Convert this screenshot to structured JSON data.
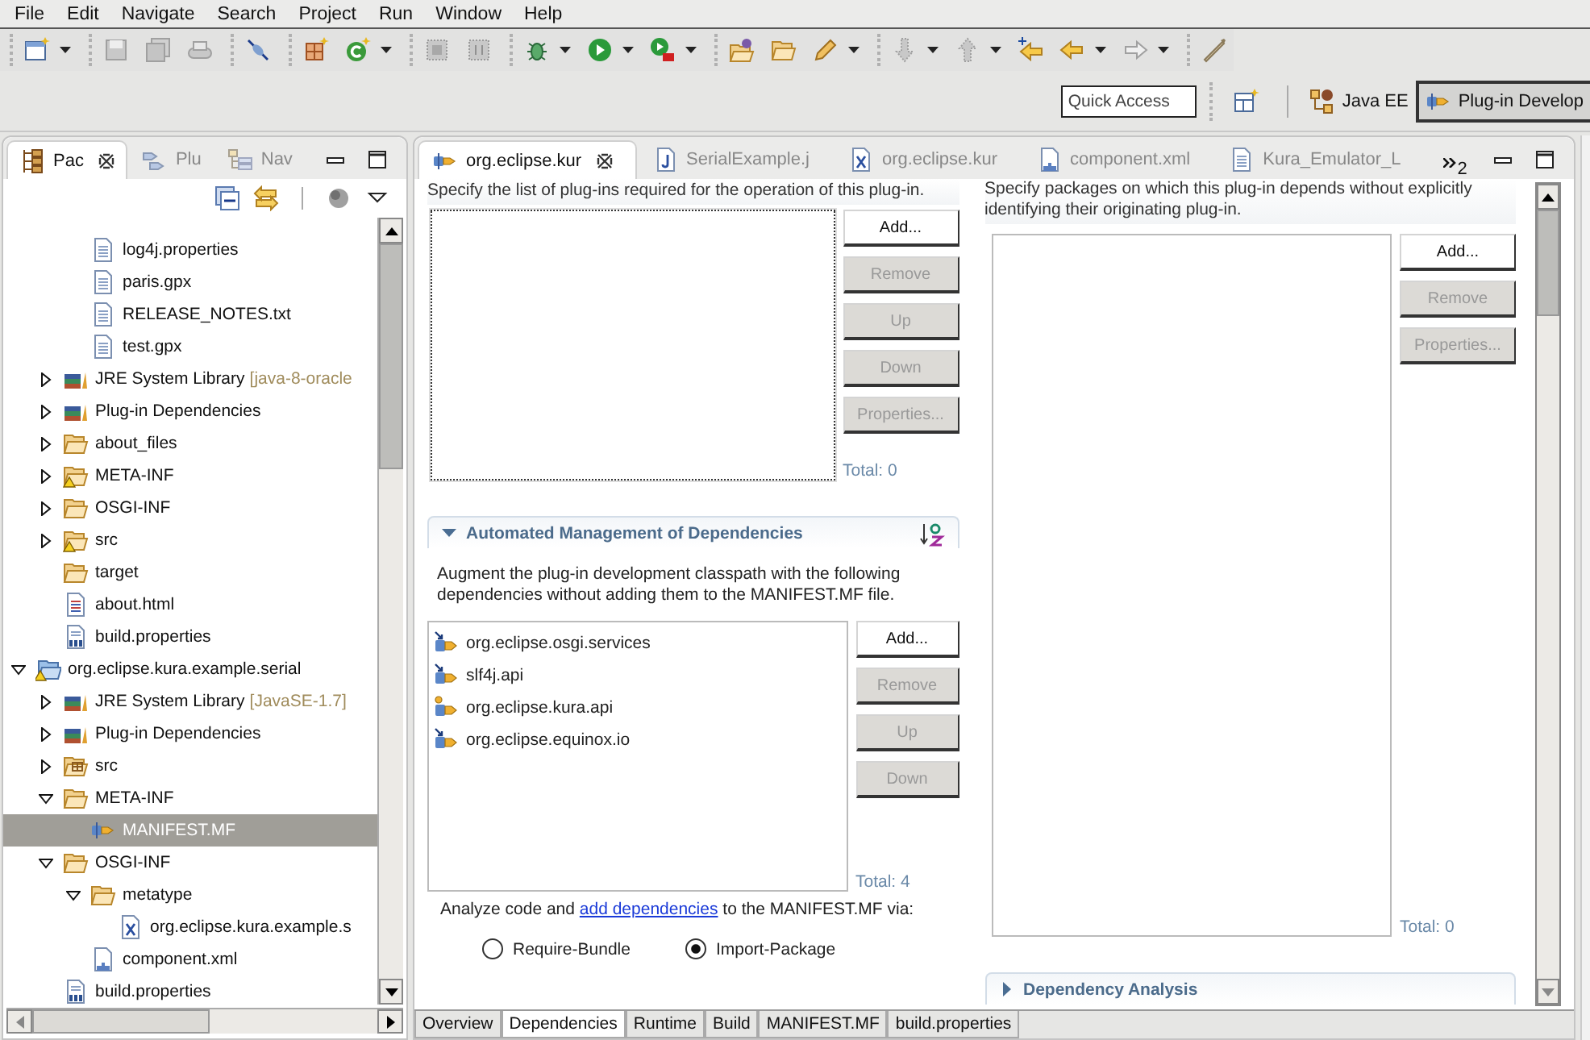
{
  "menu": [
    {
      "label": "File"
    },
    {
      "label": "Edit"
    },
    {
      "label": "Navigate"
    },
    {
      "label": "Search"
    },
    {
      "label": "Project"
    },
    {
      "label": "Run"
    },
    {
      "label": "Window"
    },
    {
      "label": "Help"
    }
  ],
  "quick_access": {
    "placeholder": "Quick Access"
  },
  "perspectives": [
    {
      "label": "Java EE",
      "kind": "java-ee",
      "selected": false
    },
    {
      "label": "Plug-in Develop",
      "kind": "plugin",
      "selected": true
    }
  ],
  "side_panel": {
    "tabs": [
      {
        "label": "Pac",
        "kind": "package",
        "selected": true
      },
      {
        "label": "Plu",
        "kind": "plugins",
        "selected": false
      },
      {
        "label": "Nav",
        "kind": "navigator",
        "selected": false
      }
    ],
    "tree": [
      {
        "children": [
          {
            "children": [
              {
                "label": "log4j.properties",
                "kind": "file",
                "selected": false
              },
              {
                "label": "paris.gpx",
                "kind": "file",
                "selected": false
              },
              {
                "label": "RELEASE_NOTES.txt",
                "kind": "file",
                "selected": false
              },
              {
                "label": "test.gpx",
                "kind": "file",
                "selected": false
              }
            ]
          },
          {
            "label": "JRE System Library",
            "decoration": "[java-8-oracle",
            "kind": "library",
            "expanded": false,
            "selected": false
          },
          {
            "label": "Plug-in Dependencies",
            "kind": "library",
            "expanded": false,
            "selected": false
          },
          {
            "label": "about_files",
            "kind": "folder",
            "expanded": false,
            "selected": false
          },
          {
            "label": "META-INF",
            "kind": "folder-warning",
            "expanded": false,
            "selected": false
          },
          {
            "label": "OSGI-INF",
            "kind": "folder",
            "expanded": false,
            "selected": false
          },
          {
            "label": "src",
            "kind": "folder-warning",
            "expanded": false,
            "selected": false
          },
          {
            "label": "target",
            "kind": "folder",
            "selected": false
          },
          {
            "label": "about.html",
            "kind": "html",
            "selected": false
          },
          {
            "label": "build.properties",
            "kind": "properties",
            "selected": false
          }
        ]
      },
      {
        "label": "org.eclipse.kura.example.serial",
        "kind": "project",
        "expanded": true,
        "selected": false,
        "children": [
          {
            "label": "JRE System Library",
            "decoration": "[JavaSE-1.7]",
            "kind": "library",
            "expanded": false,
            "selected": false
          },
          {
            "label": "Plug-in Dependencies",
            "kind": "library",
            "expanded": false,
            "selected": false
          },
          {
            "label": "src",
            "kind": "package-folder",
            "expanded": false,
            "selected": false
          },
          {
            "label": "META-INF",
            "kind": "folder",
            "expanded": true,
            "selected": false,
            "children": [
              {
                "label": "MANIFEST.MF",
                "kind": "manifest",
                "selected": true
              }
            ]
          },
          {
            "label": "OSGI-INF",
            "kind": "folder",
            "expanded": true,
            "selected": false,
            "children": [
              {
                "label": "metatype",
                "kind": "folder",
                "expanded": true,
                "selected": false,
                "children": [
                  {
                    "label": "org.eclipse.kura.example.s",
                    "kind": "xml",
                    "selected": false
                  }
                ]
              },
              {
                "label": "component.xml",
                "kind": "component",
                "selected": false
              }
            ]
          },
          {
            "label": "build.properties",
            "kind": "properties",
            "selected": false
          }
        ]
      }
    ]
  },
  "editor": {
    "tabs": [
      {
        "label": "org.eclipse.kur",
        "kind": "manifest",
        "selected": true
      },
      {
        "label": "SerialExample.j",
        "kind": "java",
        "selected": false
      },
      {
        "label": "org.eclipse.kur",
        "kind": "xml",
        "selected": false
      },
      {
        "label": "component.xml",
        "kind": "component",
        "selected": false
      },
      {
        "label": "Kura_Emulator_L",
        "kind": "text",
        "selected": false
      }
    ],
    "hidden_tabs_count": "2",
    "required_plugins": {
      "description": "Specify the list of plug-ins required for the operation of this plug-in.",
      "buttons": [
        {
          "label": "Add...",
          "disabled": false
        },
        {
          "label": "Remove",
          "disabled": true
        },
        {
          "label": "Up",
          "disabled": true
        },
        {
          "label": "Down",
          "disabled": true
        },
        {
          "label": "Properties...",
          "disabled": true
        }
      ],
      "total": "Total: 0"
    },
    "automated_management": {
      "title": "Automated Management of Dependencies",
      "expanded": true,
      "description": "Augment the plug-in development classpath with the following dependencies without adding them to the MANIFEST.MF file.",
      "items": [
        {
          "label": "org.eclipse.osgi.services",
          "kind": "imported"
        },
        {
          "label": "slf4j.api",
          "kind": "imported"
        },
        {
          "label": "org.eclipse.kura.api",
          "kind": "workspace"
        },
        {
          "label": "org.eclipse.equinox.io",
          "kind": "imported"
        }
      ],
      "buttons": [
        {
          "label": "Add...",
          "disabled": false
        },
        {
          "label": "Remove",
          "disabled": true
        },
        {
          "label": "Up",
          "disabled": true
        },
        {
          "label": "Down",
          "disabled": true
        }
      ],
      "total": "Total: 4",
      "analyze_before": "Analyze code and",
      "analyze_link": "add dependencies",
      "analyze_after": "to the MANIFEST.MF via:",
      "options": [
        {
          "label": "Require-Bundle",
          "selected": false
        },
        {
          "label": "Import-Package",
          "selected": true
        }
      ]
    },
    "imported_packages": {
      "description": "Specify packages on which this plug-in depends without explicitly identifying their originating plug-in.",
      "buttons": [
        {
          "label": "Add...",
          "disabled": false
        },
        {
          "label": "Remove",
          "disabled": true
        },
        {
          "label": "Properties...",
          "disabled": true
        }
      ],
      "total": "Total: 0"
    },
    "dependency_analysis": {
      "title": "Dependency Analysis",
      "expanded": false
    },
    "page_tabs": [
      {
        "label": "Overview",
        "selected": false
      },
      {
        "label": "Dependencies",
        "selected": true
      },
      {
        "label": "Runtime",
        "selected": false
      },
      {
        "label": "Build",
        "selected": false
      },
      {
        "label": "MANIFEST.MF",
        "selected": false
      },
      {
        "label": "build.properties",
        "selected": false
      }
    ]
  }
}
